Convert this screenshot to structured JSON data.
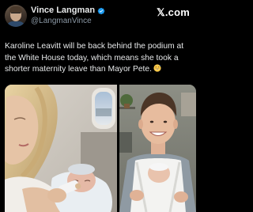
{
  "post": {
    "author": {
      "display_name": "Vince Langman",
      "handle": "@LangmanVince",
      "verified": true
    },
    "brand": "𝕏.com",
    "text": "Karoline Leavitt will be back behind the podium at the White House today, which means she took a shorter maternity leave than Mayor Pete.",
    "emoji_icon": "grinning-sweat-emoji",
    "media": [
      {
        "kind": "photo",
        "description_icon": "woman-bottle-feeding-baby-on-plane-photo"
      },
      {
        "kind": "photo",
        "description_icon": "man-holding-baby-in-carrier-photo"
      }
    ]
  },
  "colors": {
    "background": "#000000",
    "text": "#e7e9ea",
    "secondary_text": "#8b98a5",
    "verified_blue": "#1d9bf0"
  }
}
